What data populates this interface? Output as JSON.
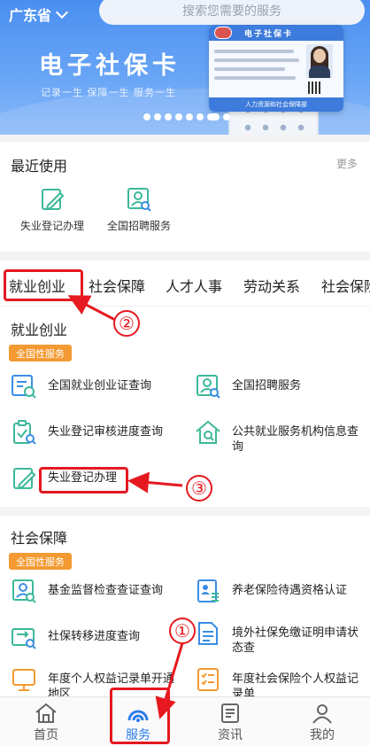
{
  "header": {
    "province": "广东省",
    "search_placeholder": "搜索您需要的服务"
  },
  "banner": {
    "title": "电子社保卡",
    "subtitle": "记录一生  保障一生  服务一生",
    "card_title": "电子社保卡",
    "card_footer": "人力资源和社会保障部",
    "page_dots": 8,
    "active_dot": 7
  },
  "recent": {
    "title": "最近使用",
    "more_label": "更多",
    "items": [
      {
        "label": "失业登记办理",
        "icon": "pencil-doc-icon"
      },
      {
        "label": "全国招聘服务",
        "icon": "person-search-icon"
      }
    ]
  },
  "tabs": [
    {
      "label": "就业创业",
      "active": true
    },
    {
      "label": "社会保障",
      "active": false
    },
    {
      "label": "人才人事",
      "active": false
    },
    {
      "label": "劳动关系",
      "active": false
    },
    {
      "label": "社会保险",
      "active": false
    }
  ],
  "employment": {
    "title": "就业创业",
    "badge": "全国性服务",
    "items": [
      {
        "label": "全国就业创业证查询",
        "icon": "list-search-icon"
      },
      {
        "label": "全国招聘服务",
        "icon": "person-search-icon"
      },
      {
        "label": "失业登记审核进度查询",
        "icon": "clipboard-check-icon"
      },
      {
        "label": "公共就业服务机构信息查询",
        "icon": "house-search-icon"
      },
      {
        "label": "失业登记办理",
        "icon": "pencil-doc-icon"
      }
    ]
  },
  "social": {
    "title": "社会保障",
    "badge": "全国性服务",
    "items": [
      {
        "label": "基金监督检查查证查询",
        "icon": "fund-search-icon"
      },
      {
        "label": "养老保险待遇资格认证",
        "icon": "person-card-icon"
      },
      {
        "label": "社保转移进度查询",
        "icon": "transfer-search-icon"
      },
      {
        "label": "境外社保免缴证明申请状态查",
        "icon": "document-icon"
      },
      {
        "label": "年度个人权益记录单开通地区",
        "icon": "monitor-icon"
      },
      {
        "label": "年度社会保险个人权益记录单",
        "icon": "checklist-icon"
      }
    ]
  },
  "nav": [
    {
      "label": "首页",
      "icon": "home-icon",
      "active": false
    },
    {
      "label": "服务",
      "icon": "service-icon",
      "active": true
    },
    {
      "label": "资讯",
      "icon": "news-icon",
      "active": false
    },
    {
      "label": "我的",
      "icon": "user-icon",
      "active": false
    }
  ],
  "annotations": {
    "step1": "①",
    "step2": "②",
    "step3": "③"
  },
  "colors": {
    "accent": "#2b7de9",
    "icon_blue": "#3a8de4",
    "icon_green": "#3cb89a",
    "badge": "#f39a32",
    "annotation_red": "#e5191f"
  }
}
